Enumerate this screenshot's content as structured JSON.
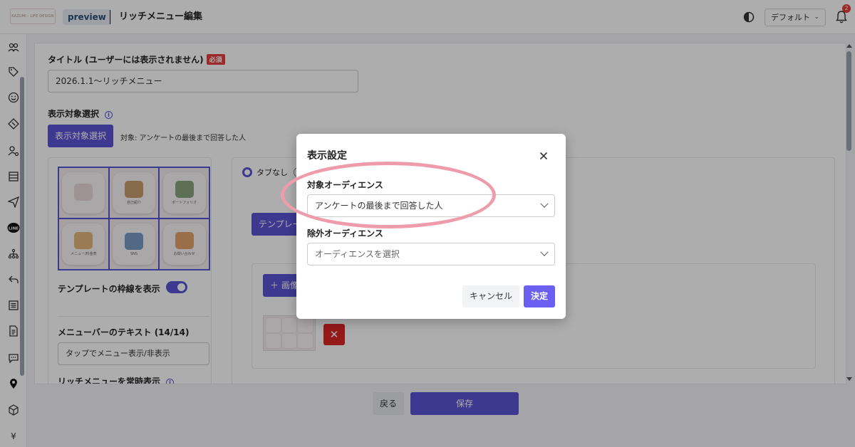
{
  "header": {
    "logo_text": "KAZUMI · LIFE DESIGN",
    "preview_label": "preview",
    "page_title": "リッチメニュー編集",
    "theme_select_value": "デフォルト",
    "notification_count": "2"
  },
  "sidebar": {
    "icons": [
      "users-icon",
      "tag-icon",
      "smiley-icon",
      "ticket-icon",
      "user-settings-icon",
      "table-icon",
      "send-icon",
      "line-icon",
      "org-chart-icon",
      "reply-icon",
      "list-icon",
      "document-icon",
      "chat-icon",
      "location-pin-icon",
      "cube-icon",
      "yen-icon"
    ],
    "line_label": "LINE",
    "yen_label": "¥"
  },
  "form": {
    "title_label": "タイトル (ユーザーには表示されません)",
    "required_badge": "必須",
    "title_value": "2026.1.1〜リッチメニュー",
    "target_section_label": "表示対象選択",
    "target_button": "表示対象選択",
    "target_note": "対象: アンケートの最後まで回答した人",
    "tiles": [
      {
        "caption": "",
        "art": "#e9d9da"
      },
      {
        "caption": "自己紹介",
        "art": "#c69c6d"
      },
      {
        "caption": "ポートフォリオ",
        "art": "#8aa57e"
      },
      {
        "caption": "メニュー/料金表",
        "art": "#e3b77d"
      },
      {
        "caption": "SNS",
        "art": "#7a9bc6"
      },
      {
        "caption": "お問い合わせ",
        "art": "#e4a36a"
      }
    ],
    "show_template_border_label": "テンプレートの枠線を表示",
    "menu_bar_text_label": "メニューバーのテキスト (14/14)",
    "menu_bar_text_value": "タップでメニュー表示/非表示",
    "always_show_label": "リッチメニューを常時表示",
    "tab_none_label": "タブなし",
    "template_button": "テンプレート",
    "add_image_button": "＋ 画像",
    "delete_icon": "✕"
  },
  "footer": {
    "back_label": "戻る",
    "save_label": "保存"
  },
  "modal": {
    "title": "表示設定",
    "target_audience_label": "対象オーディエンス",
    "target_audience_value": "アンケートの最後まで回答した人",
    "exclude_audience_label": "除外オーディエンス",
    "exclude_audience_placeholder": "オーディエンスを選択",
    "cancel_label": "キャンセル",
    "ok_label": "決定"
  },
  "colors": {
    "primary": "#5b54d6",
    "danger": "#dc2626",
    "highlight": "#ee9cac"
  }
}
